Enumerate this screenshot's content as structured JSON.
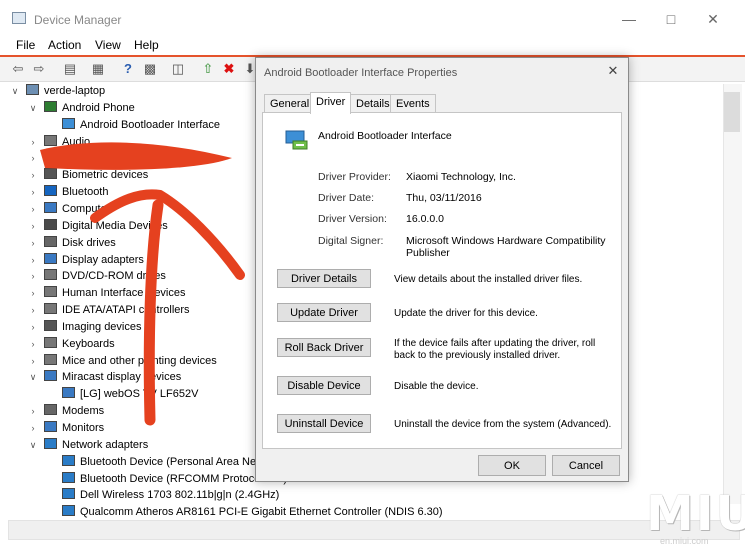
{
  "window": {
    "title": "Device Manager"
  },
  "menu": [
    "File",
    "Action",
    "View",
    "Help"
  ],
  "tree": [
    {
      "label": "verde-laptop",
      "level": 0,
      "expander": "down",
      "icon": "computer-icon"
    },
    {
      "label": "Android Phone",
      "level": 1,
      "expander": "down",
      "icon": "folder-icon"
    },
    {
      "label": "Android Bootloader Interface",
      "level": 2,
      "expander": "",
      "icon": "usb-device-icon"
    },
    {
      "label": "Audio",
      "level": 1,
      "expander": "right",
      "icon": "audio-icon"
    },
    {
      "label": "",
      "level": 1,
      "expander": "right",
      "icon": "device-icon"
    },
    {
      "label": "Biometric devices",
      "level": 1,
      "expander": "right",
      "icon": "biometric-icon"
    },
    {
      "label": "Bluetooth",
      "level": 1,
      "expander": "right",
      "icon": "bluetooth-icon"
    },
    {
      "label": "Computer",
      "level": 1,
      "expander": "right",
      "icon": "monitor-icon"
    },
    {
      "label": "Digital Media Devices",
      "level": 1,
      "expander": "right",
      "icon": "media-icon"
    },
    {
      "label": "Disk drives",
      "level": 1,
      "expander": "right",
      "icon": "disk-icon"
    },
    {
      "label": "Display adapters",
      "level": 1,
      "expander": "right",
      "icon": "display-icon"
    },
    {
      "label": "DVD/CD-ROM drives",
      "level": 1,
      "expander": "right",
      "icon": "dvd-icon"
    },
    {
      "label": "Human Interface Devices",
      "level": 1,
      "expander": "right",
      "icon": "hid-icon"
    },
    {
      "label": "IDE ATA/ATAPI controllers",
      "level": 1,
      "expander": "right",
      "icon": "ide-icon"
    },
    {
      "label": "Imaging devices",
      "level": 1,
      "expander": "right",
      "icon": "camera-icon"
    },
    {
      "label": "Keyboards",
      "level": 1,
      "expander": "right",
      "icon": "keyboard-icon"
    },
    {
      "label": "Mice and other pointing devices",
      "level": 1,
      "expander": "right",
      "icon": "mouse-icon"
    },
    {
      "label": "Miracast display devices",
      "level": 1,
      "expander": "down",
      "icon": "display-icon"
    },
    {
      "label": "[LG] webOS TV LF652V",
      "level": 2,
      "expander": "",
      "icon": "tv-icon"
    },
    {
      "label": "Modems",
      "level": 1,
      "expander": "right",
      "icon": "modem-icon"
    },
    {
      "label": "Monitors",
      "level": 1,
      "expander": "right",
      "icon": "monitor-icon"
    },
    {
      "label": "Network adapters",
      "level": 1,
      "expander": "down",
      "icon": "network-icon"
    },
    {
      "label": "Bluetooth Device (Personal Area Network)",
      "level": 2,
      "expander": "",
      "icon": "network-icon"
    },
    {
      "label": "Bluetooth Device (RFCOMM Protocol TDI)",
      "level": 2,
      "expander": "",
      "icon": "network-icon"
    },
    {
      "label": "Dell Wireless 1703 802.11b|g|n (2.4GHz)",
      "level": 2,
      "expander": "",
      "icon": "network-icon"
    },
    {
      "label": "Qualcomm Atheros AR8161 PCI-E Gigabit Ethernet Controller (NDIS 6.30)",
      "level": 2,
      "expander": "",
      "icon": "network-icon"
    }
  ],
  "dialog": {
    "title": "Android Bootloader Interface Properties",
    "tabs": [
      "General",
      "Driver",
      "Details",
      "Events"
    ],
    "active_tab": "Driver",
    "device_name": "Android Bootloader Interface",
    "fields": [
      {
        "label": "Driver Provider:",
        "value": "Xiaomi Technology, Inc."
      },
      {
        "label": "Driver Date:",
        "value": "Thu, 03/11/2016"
      },
      {
        "label": "Driver Version:",
        "value": "16.0.0.0"
      },
      {
        "label": "Digital Signer:",
        "value": "Microsoft Windows Hardware Compatibility Publisher"
      }
    ],
    "actions": [
      {
        "button": "Driver Details",
        "desc": "View details about the installed driver files."
      },
      {
        "button": "Update Driver",
        "desc": "Update the driver for this device."
      },
      {
        "button": "Roll Back Driver",
        "desc": "If the device fails after updating the driver, roll back to the previously installed driver."
      },
      {
        "button": "Disable Device",
        "desc": "Disable the device."
      },
      {
        "button": "Uninstall Device",
        "desc": "Uninstall the device from the system (Advanced)."
      }
    ],
    "ok": "OK",
    "cancel": "Cancel"
  },
  "watermark": {
    "logo": "MIUI",
    "sub": "en.miui.com"
  },
  "colors": {
    "annotation": "#e5411f",
    "accent_bar": "#e5532c"
  }
}
